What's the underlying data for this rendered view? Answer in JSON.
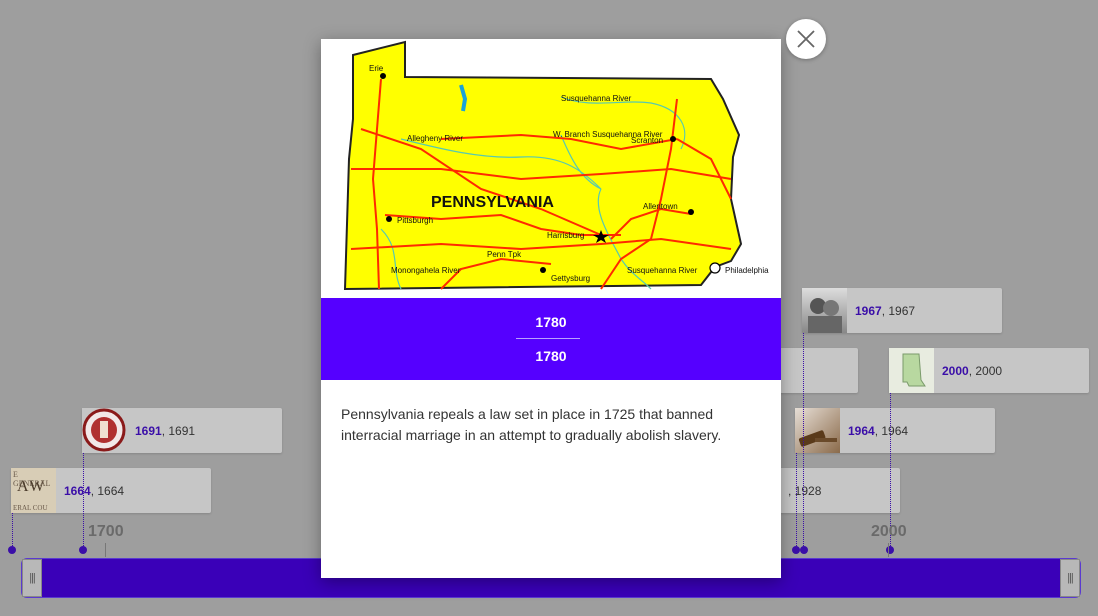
{
  "timeline": {
    "events": [
      {
        "id": "1664",
        "title": "1664",
        "date": "1664"
      },
      {
        "id": "1691",
        "title": "1691",
        "date": "1691"
      },
      {
        "id": "1928",
        "title": "",
        "date": ", 1928"
      },
      {
        "id": "1964",
        "title": "1964",
        "date": "1964"
      },
      {
        "id": "1967",
        "title": "1967",
        "date": "1967"
      },
      {
        "id": "2000",
        "title": "2000",
        "date": "2000"
      }
    ],
    "axis_labels": [
      "1700",
      "2000"
    ],
    "handle_left": "|||",
    "handle_right": "|||"
  },
  "modal": {
    "map": {
      "state_name": "PENNSYLVANIA",
      "cities": [
        "Erie",
        "Scranton",
        "Pittsburgh",
        "Allentown",
        "Harrisburg",
        "Gettysburg",
        "Philadelphia"
      ],
      "rivers": [
        "Susquehanna River",
        "W. Branch Susquehanna River",
        "Allegheny River",
        "Monongahela River",
        "Susquehanna River"
      ],
      "road_label": "Penn Tpk",
      "colors": {
        "land": "#ffff00",
        "roads": "#ff2a00",
        "rivers": "#2ab7e0"
      }
    },
    "start_date": "1780",
    "end_date": "1780",
    "description": "Pennsylvania repeals a law set in place in 1725 that banned interracial marriage in an attempt to gradually abolish slavery.",
    "band_color": "#5500ff",
    "close_icon": "close-icon"
  }
}
